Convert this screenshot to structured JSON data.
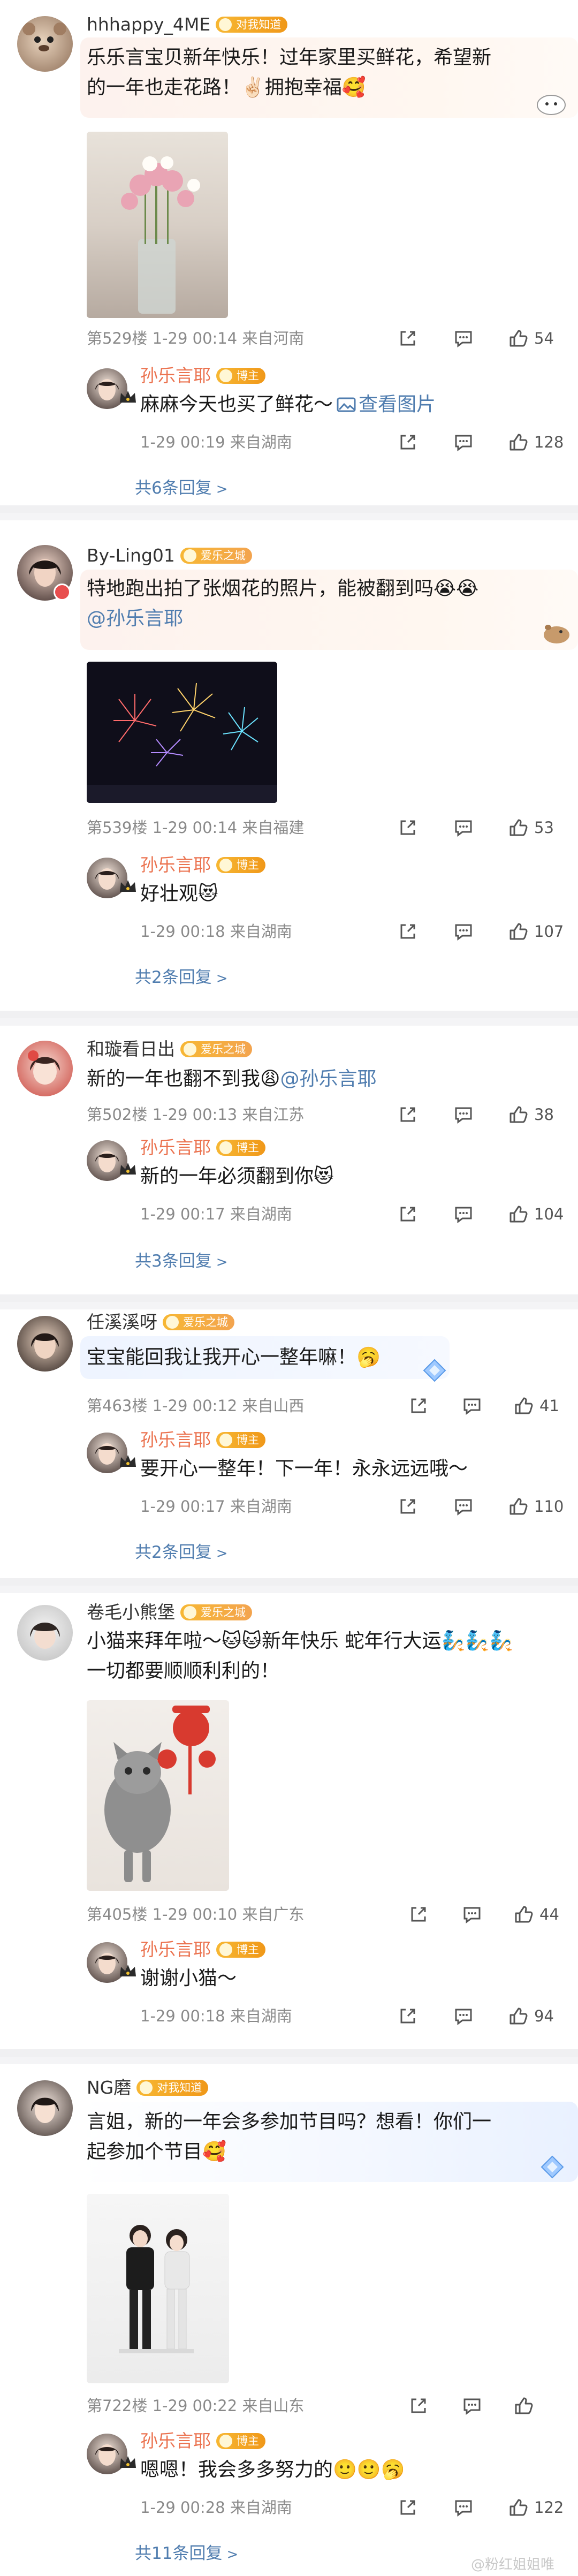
{
  "threads": [
    {
      "user": "hhhappy_4ME",
      "badge": "对我知道",
      "text_lines": [
        "乐乐言宝贝新年快乐！过年家里买鲜花，希望新",
        "的一年也走花路！✌🏻拥抱幸福🥰"
      ],
      "floor": "第529楼",
      "time": "1-29 00:14",
      "location": "来自河南",
      "likes": "54",
      "reply": {
        "user": "孙乐言耶",
        "badge": "博主",
        "text": "麻麻今天也买了鲜花～",
        "link_text": "查看图片",
        "time": "1-29 00:19",
        "location": "来自湖南",
        "likes": "128"
      },
      "more_replies": "共6条回复"
    },
    {
      "user": "By-Ling01",
      "badge": "爱乐之城",
      "text_lines": [
        "特地跑出拍了张烟花的照片，能被翻到吗😭😭",
        "@孙乐言耶"
      ],
      "floor": "第539楼",
      "time": "1-29 00:14",
      "location": "来自福建",
      "likes": "53",
      "reply": {
        "user": "孙乐言耶",
        "badge": "博主",
        "text": "好壮观😻",
        "time": "1-29 00:18",
        "location": "来自湖南",
        "likes": "107"
      },
      "more_replies": "共2条回复"
    },
    {
      "user": "和璇看日出",
      "badge": "爱乐之城",
      "text_pre": "新的一年也翻不到我😩",
      "text_at": "@孙乐言耶",
      "floor": "第502楼",
      "time": "1-29 00:13",
      "location": "来自江苏",
      "likes": "38",
      "reply": {
        "user": "孙乐言耶",
        "badge": "博主",
        "text": "新的一年必须翻到你😻",
        "time": "1-29 00:17",
        "location": "来自湖南",
        "likes": "104"
      },
      "more_replies": "共3条回复"
    },
    {
      "user": "任溪溪呀",
      "badge": "爱乐之城",
      "text_lines": [
        "宝宝能回我让我开心一整年嘛！🥱"
      ],
      "floor": "第463楼",
      "time": "1-29 00:12",
      "location": "来自山西",
      "likes": "41",
      "reply": {
        "user": "孙乐言耶",
        "badge": "博主",
        "text": "要开心一整年！下一年！永永远远哦～",
        "time": "1-29 00:17",
        "location": "来自湖南",
        "likes": "110"
      },
      "more_replies": "共2条回复"
    },
    {
      "user": "卷毛小熊堡",
      "badge": "爱乐之城",
      "text_lines": [
        "小猫来拜年啦～🐱🐱新年快乐 蛇年行大运🧞🧞🧞",
        "一切都要顺顺利利的！"
      ],
      "floor": "第405楼",
      "time": "1-29 00:10",
      "location": "来自广东",
      "likes": "44",
      "reply": {
        "user": "孙乐言耶",
        "badge": "博主",
        "text": "谢谢小猫～",
        "time": "1-29 00:18",
        "location": "来自湖南",
        "likes": "94"
      },
      "more_replies": null
    },
    {
      "user": "NG磨",
      "badge": "对我知道",
      "text_lines": [
        "言姐，新的一年会多参加节目吗？想看！你们一",
        "起参加个节目🥰"
      ],
      "floor": "第722楼",
      "time": "1-29 00:22",
      "location": "来自山东",
      "likes": "",
      "reply": {
        "user": "孙乐言耶",
        "badge": "博主",
        "text": "嗯嗯！我会多多努力的🙂🙂🥱",
        "time": "1-29 00:28",
        "location": "来自湖南",
        "likes": "122"
      },
      "more_replies": "共11条回复"
    }
  ],
  "watermark": "@粉红姐姐唯",
  "icons": {
    "share": "share-icon",
    "comment": "comment-icon",
    "like": "thumbs-up-icon",
    "more": "chevron-right-icon",
    "image": "image-icon",
    "verified_crown": "crown-icon"
  },
  "colors": {
    "username_orange": "#eb7350",
    "link_blue": "#507daf",
    "meta_gray": "#8a8a8a",
    "badge_gold": "#f09819"
  }
}
